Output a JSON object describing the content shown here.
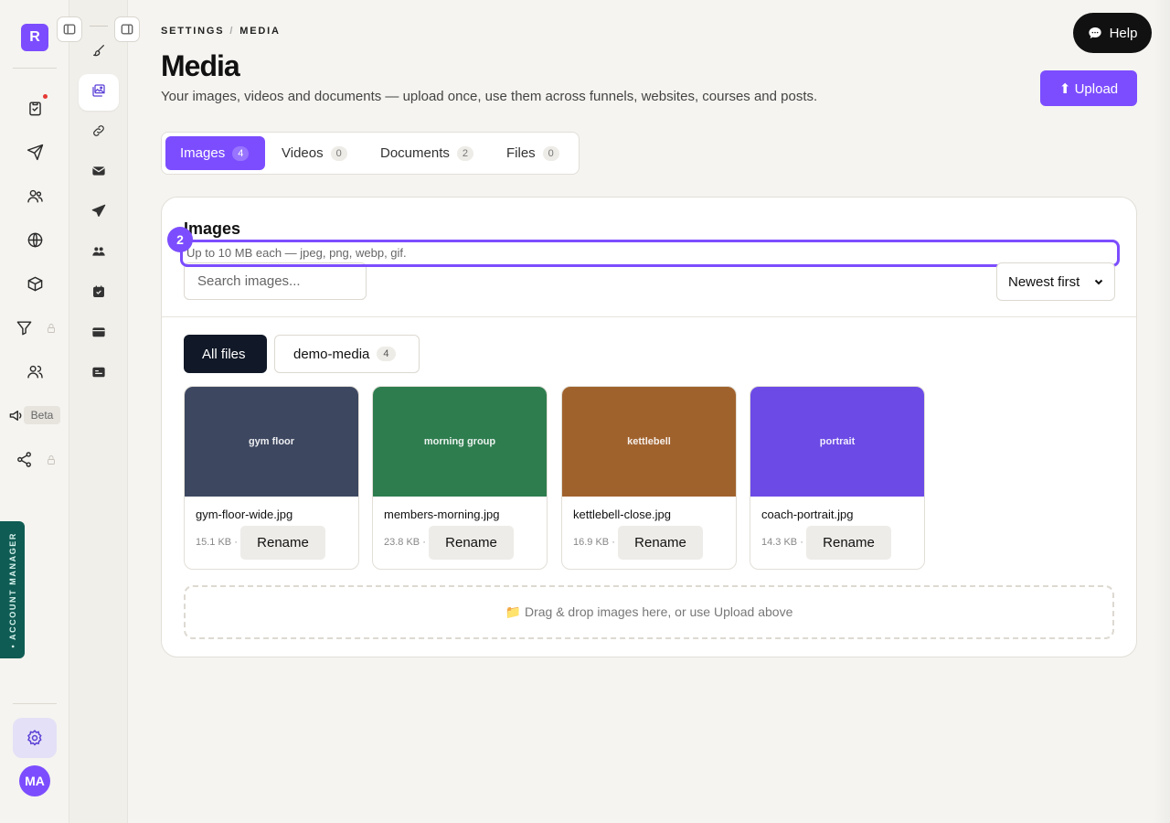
{
  "rail": {
    "logo_letter": "R",
    "beta_label": "Beta",
    "account_manager_label": "• ACCOUNT MANAGER",
    "avatar_initials": "MA"
  },
  "breadcrumb": {
    "parent": "SETTINGS",
    "separator": "/",
    "current": "MEDIA"
  },
  "header": {
    "title": "Media",
    "subtitle": "Your images, videos and documents — upload once, use them across funnels, websites, courses and posts.",
    "help_label": "Help",
    "upload_label": "⬆ Upload"
  },
  "tabs": [
    {
      "label": "Images",
      "count": "4"
    },
    {
      "label": "Videos",
      "count": "0"
    },
    {
      "label": "Documents",
      "count": "2"
    },
    {
      "label": "Files",
      "count": "0"
    }
  ],
  "panel": {
    "title": "Images",
    "hint": "Up to 10 MB each — jpeg, png, webp, gif.",
    "hint_badge": "2",
    "search_placeholder": "Search images...",
    "sort_value": "Newest first"
  },
  "folders": {
    "all_label": "All files",
    "demo_label": "demo-media",
    "demo_count": "4"
  },
  "tiles": [
    {
      "thumb_label": "gym floor",
      "name": "gym-floor-wide.jpg",
      "size": "15.1 KB ·",
      "rename": "Rename",
      "color": "#3d4760"
    },
    {
      "thumb_label": "morning group",
      "name": "members-morning.jpg",
      "size": "23.8 KB ·",
      "rename": "Rename",
      "color": "#2e7d4f"
    },
    {
      "thumb_label": "kettlebell",
      "name": "kettlebell-close.jpg",
      "size": "16.9 KB ·",
      "rename": "Rename",
      "color": "#a0622d"
    },
    {
      "thumb_label": "portrait",
      "name": "coach-portrait.jpg",
      "size": "14.3 KB ·",
      "rename": "Rename",
      "color": "#6c4ae6"
    }
  ],
  "dropzone_label": "📁 Drag & drop images here, or use Upload above",
  "colors": {
    "accent": "#7c4dff",
    "dark": "#111827",
    "teal": "#0f5c54"
  }
}
